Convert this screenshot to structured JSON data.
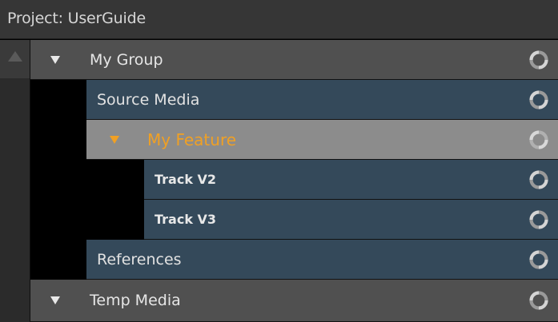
{
  "panel": {
    "title": "Project: UserGuide"
  },
  "tree": {
    "my_group": {
      "label": "My Group",
      "expanded": true,
      "icon": "sync-icon"
    },
    "source_media": {
      "label": "Source Media",
      "icon": "sync-icon"
    },
    "my_feature": {
      "label": "My Feature",
      "expanded": true,
      "selected": true,
      "icon": "sync-icon"
    },
    "track_v2": {
      "label": "Track V2",
      "icon": "sync-icon"
    },
    "track_v3": {
      "label": "Track V3",
      "icon": "sync-icon"
    },
    "references": {
      "label": "References",
      "icon": "sync-icon"
    },
    "temp_media": {
      "label": "Temp Media",
      "expanded": true,
      "icon": "sync-icon"
    }
  },
  "colors": {
    "group_row": "#505050",
    "bin_row": "#34495a",
    "selected_row": "#8c8c8c",
    "selected_text": "#f0a024"
  }
}
